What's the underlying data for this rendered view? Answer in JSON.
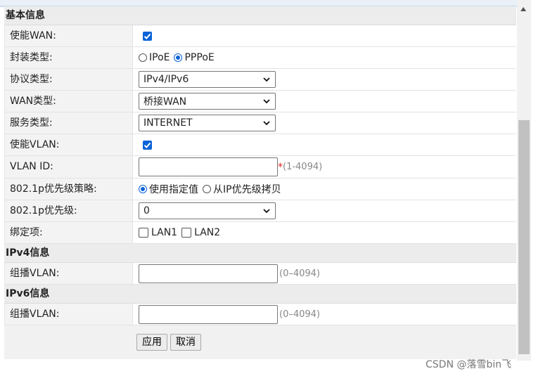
{
  "sections": {
    "basic": "基本信息",
    "ipv4": "IPv4信息",
    "ipv6": "IPv6信息"
  },
  "enable_wan": {
    "label": "使能WAN:",
    "checked": true
  },
  "encap": {
    "label": "封装类型:",
    "options": [
      "IPoE",
      "PPPoE"
    ],
    "selected": "PPPoE"
  },
  "protocol": {
    "label": "协议类型:",
    "value": "IPv4/IPv6"
  },
  "wan_type": {
    "label": "WAN类型:",
    "value": "桥接WAN"
  },
  "service_type": {
    "label": "服务类型:",
    "value": "INTERNET"
  },
  "enable_vlan": {
    "label": "使能VLAN:",
    "checked": true
  },
  "vlan_id": {
    "label": "VLAN ID:",
    "value": "",
    "required_mark": "*",
    "hint": "(1-4094)"
  },
  "priority_policy": {
    "label": "802.1p优先级策略:",
    "options": [
      "使用指定值",
      "从IP优先级拷贝"
    ],
    "selected": "使用指定值"
  },
  "priority": {
    "label": "802.1p优先级:",
    "value": "0"
  },
  "binding": {
    "label": "绑定项:",
    "options": [
      "LAN1",
      "LAN2"
    ]
  },
  "ipv4_mcast": {
    "label": "组播VLAN:",
    "value": "",
    "hint": "(0–4094)"
  },
  "ipv6_mcast": {
    "label": "组播VLAN:",
    "value": "",
    "hint": "(0–4094)"
  },
  "buttons": {
    "apply": "应用",
    "cancel": "取消"
  },
  "watermark": "CSDN @落雪bin飞",
  "colors": {
    "accent": "#0a63d8",
    "required": "#e02020",
    "section_bg": "#ececec"
  }
}
